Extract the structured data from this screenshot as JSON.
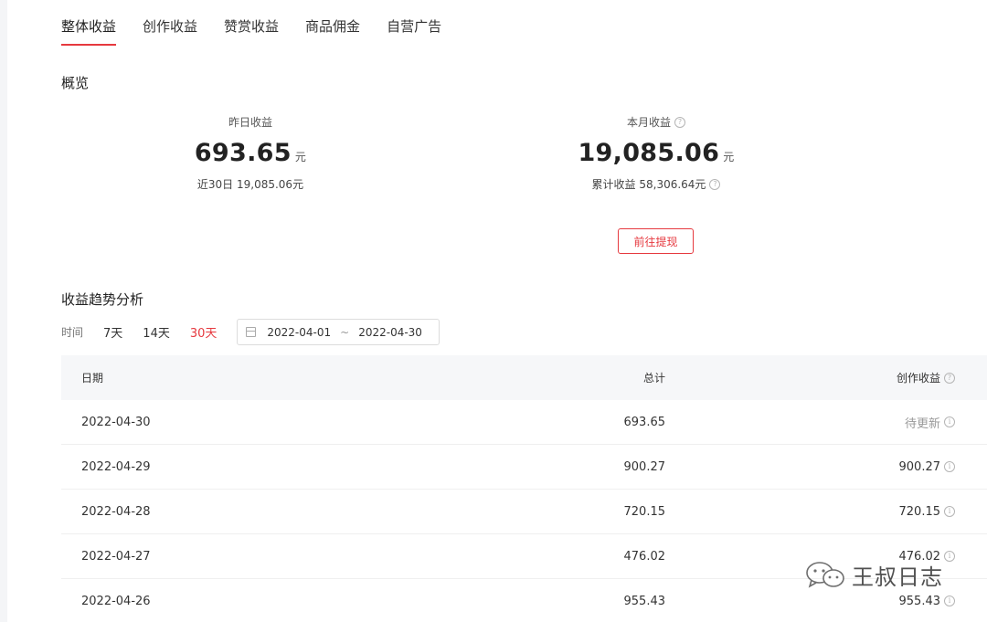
{
  "tabs": [
    "整体收益",
    "创作收益",
    "赞赏收益",
    "商品佣金",
    "自营广告"
  ],
  "overview": {
    "title": "概览",
    "yesterday": {
      "label": "昨日收益",
      "value": "693.65",
      "unit": "元",
      "sub": "近30日 19,085.06元"
    },
    "month": {
      "label": "本月收益",
      "value": "19,085.06",
      "unit": "元",
      "sub": "累计收益 58,306.64元"
    },
    "withdraw_label": "前往提现"
  },
  "trend": {
    "title": "收益趋势分析",
    "time_label": "时间",
    "ranges": [
      "7天",
      "14天",
      "30天"
    ],
    "active_range": "30天",
    "start_date": "2022-04-01",
    "separator": "~",
    "end_date": "2022-04-30"
  },
  "table": {
    "headers": {
      "date": "日期",
      "total": "总计",
      "creation": "创作收益"
    },
    "rows": [
      {
        "date": "2022-04-30",
        "total": "693.65",
        "creation": "待更新"
      },
      {
        "date": "2022-04-29",
        "total": "900.27",
        "creation": "900.27"
      },
      {
        "date": "2022-04-28",
        "total": "720.15",
        "creation": "720.15"
      },
      {
        "date": "2022-04-27",
        "total": "476.02",
        "creation": "476.02"
      },
      {
        "date": "2022-04-26",
        "total": "955.43",
        "creation": "955.43"
      }
    ]
  },
  "watermark": {
    "text": "王叔日志",
    "icon": "wechat-icon"
  },
  "colors": {
    "accent": "#e6393f",
    "header_bg": "#f6f7f9"
  }
}
